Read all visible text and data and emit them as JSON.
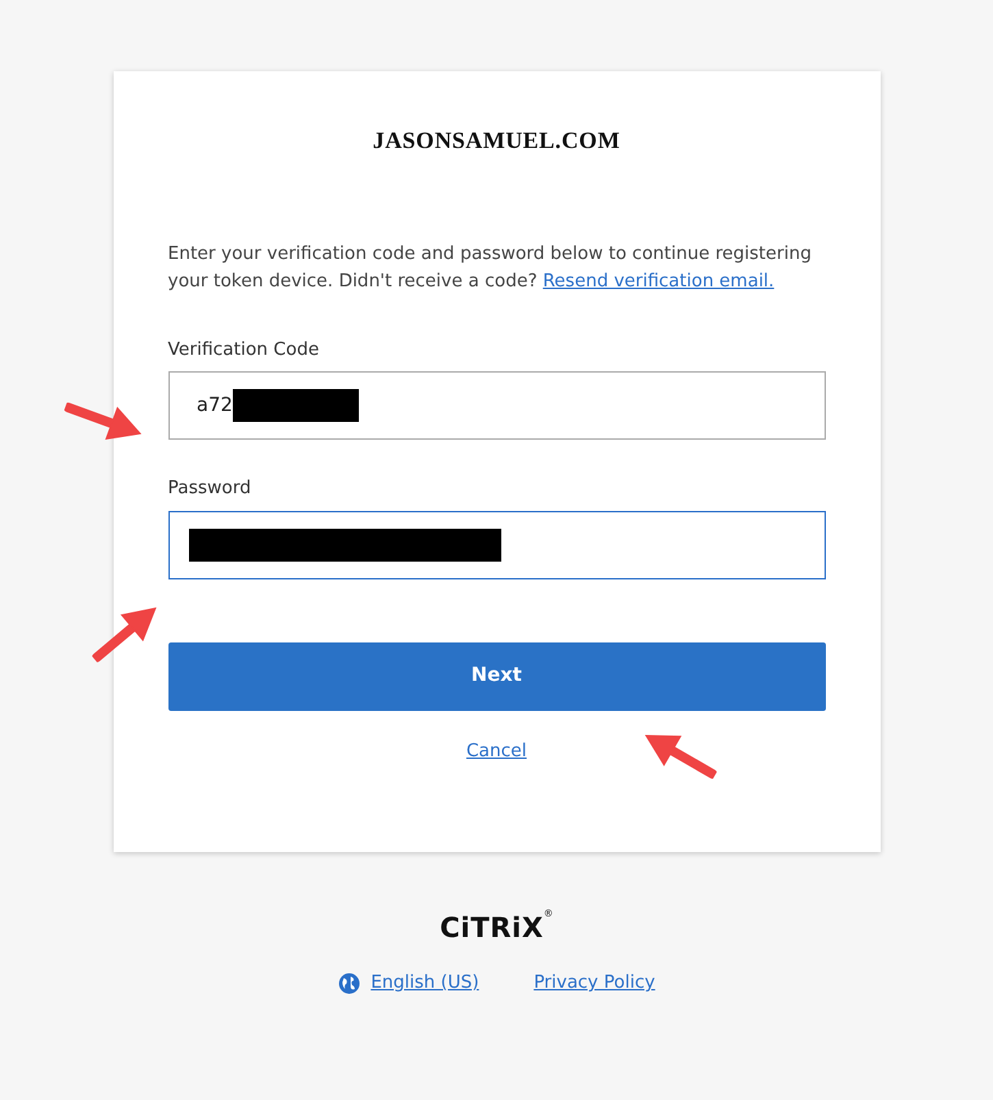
{
  "logo": "JASONSAMUEL.COM",
  "intro": {
    "text": "Enter your verification code and password below to continue registering your token device. Didn't receive a code?",
    "link": "Resend verification email."
  },
  "fields": [
    {
      "label": "Verification Code",
      "value": "a72",
      "redacted": true,
      "focused": false
    },
    {
      "label": "Password",
      "redacted": true,
      "focused": true
    }
  ],
  "next_button": "Next",
  "cancel_link": "Cancel",
  "footer": {
    "brand": "CiTRiX",
    "brand_mark": "®",
    "language": "English (US)",
    "privacy": "Privacy Policy"
  }
}
